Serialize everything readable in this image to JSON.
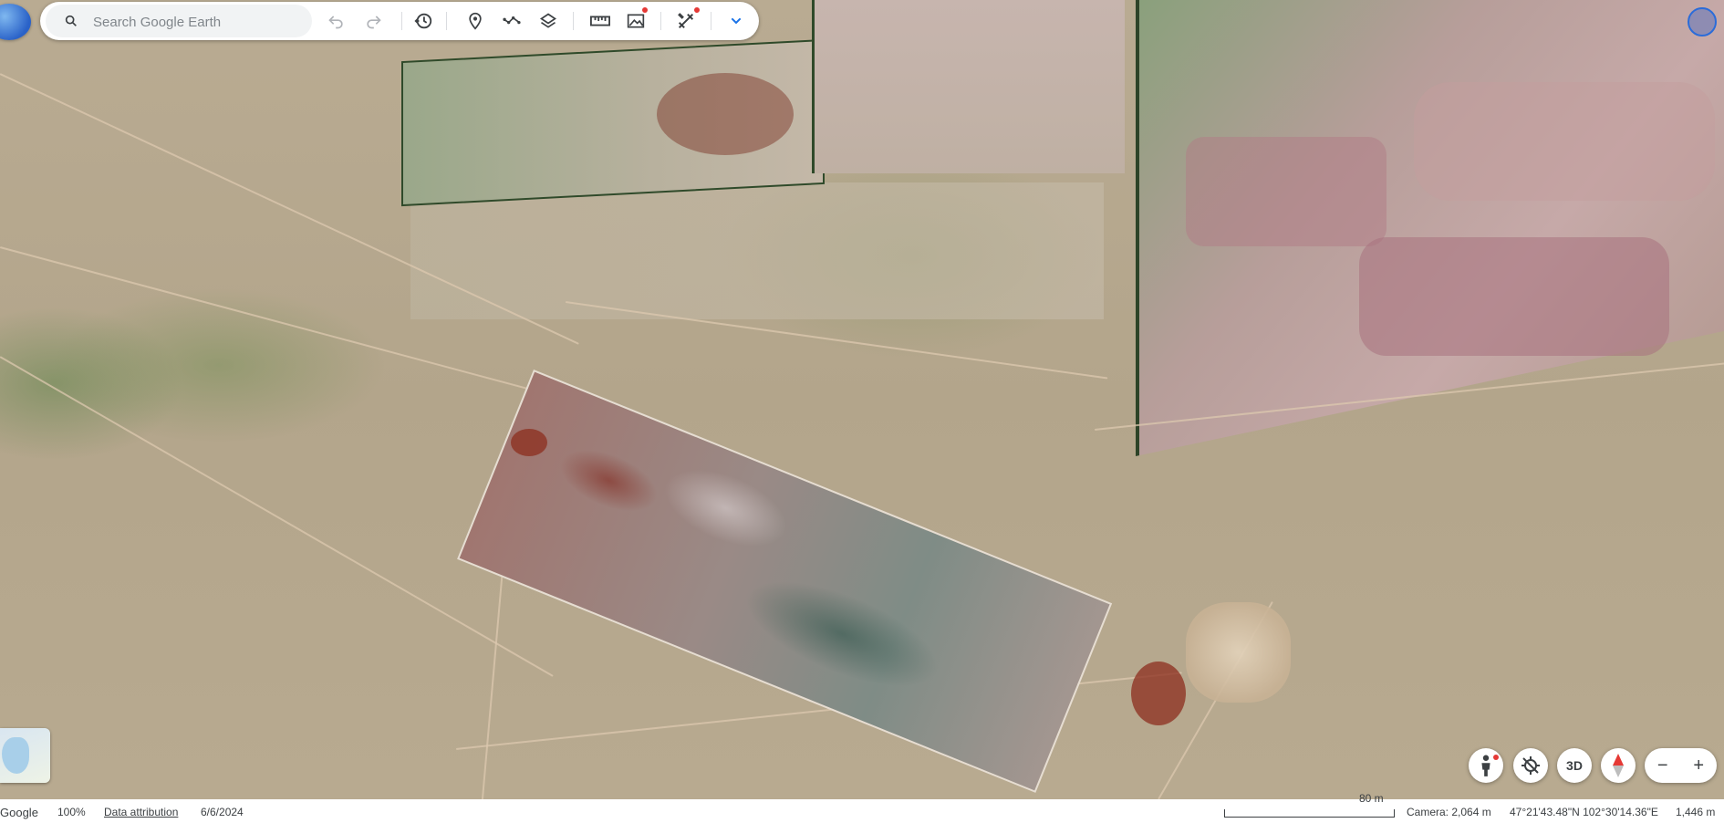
{
  "search": {
    "placeholder": "Search Google Earth"
  },
  "toolbar": {
    "buttons": [
      "undo-icon",
      "redo-icon",
      "history-icon",
      "placemark-icon",
      "path-icon",
      "layers-icon",
      "ruler-icon",
      "projects-icon",
      "tools-icon",
      "expand-icon"
    ]
  },
  "statusbar": {
    "brand": "Google",
    "zoom": "100%",
    "attribution": "Data attribution",
    "date": "6/6/2024",
    "scale": "80 m",
    "camera": "Camera: 2,064 m",
    "coordinates": "47°21'43.48\"N 102°30'14.36\"E",
    "elevation": "1,446 m"
  },
  "controls": {
    "view_3d": "3D",
    "zoom_out": "−",
    "zoom_in": "+"
  },
  "colors": {
    "accent": "#1a73e8",
    "notification": "#e53935"
  }
}
